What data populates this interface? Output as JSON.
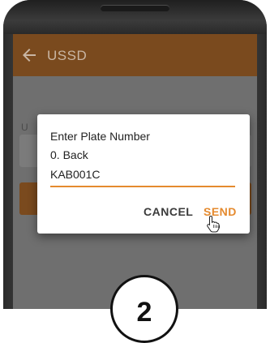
{
  "app_bar": {
    "title": "USSD",
    "back_icon": "arrow-left-icon",
    "color": "#7a4a1e"
  },
  "background_form": {
    "label_fragment": "U"
  },
  "dialog": {
    "message_line_1": "Enter Plate Number",
    "message_line_2": "0. Back",
    "input_value": "KAB001C",
    "cancel_label": "CANCEL",
    "send_label": "SEND",
    "accent_color": "#e58a2e"
  },
  "overlay": {
    "step_number": "2"
  }
}
